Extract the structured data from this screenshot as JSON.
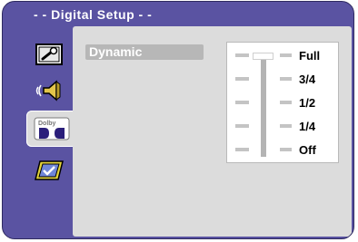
{
  "window": {
    "title": "- -  Digital Setup  - -"
  },
  "tabs": [
    {
      "icon": "wrench-icon",
      "active": false
    },
    {
      "icon": "speaker-icon",
      "active": false
    },
    {
      "icon": "dolby-icon",
      "active": true,
      "badge_text": "Dolby"
    },
    {
      "icon": "check-icon",
      "active": false
    }
  ],
  "setting": {
    "label": "Dynamic"
  },
  "slider": {
    "levels": [
      "Full",
      "3/4",
      "1/2",
      "1/4",
      "Off"
    ],
    "selected": "Full"
  },
  "colors": {
    "frame": "#5a53a2",
    "panel": "#dcdcdc",
    "highlight": "#b7b7b7"
  }
}
